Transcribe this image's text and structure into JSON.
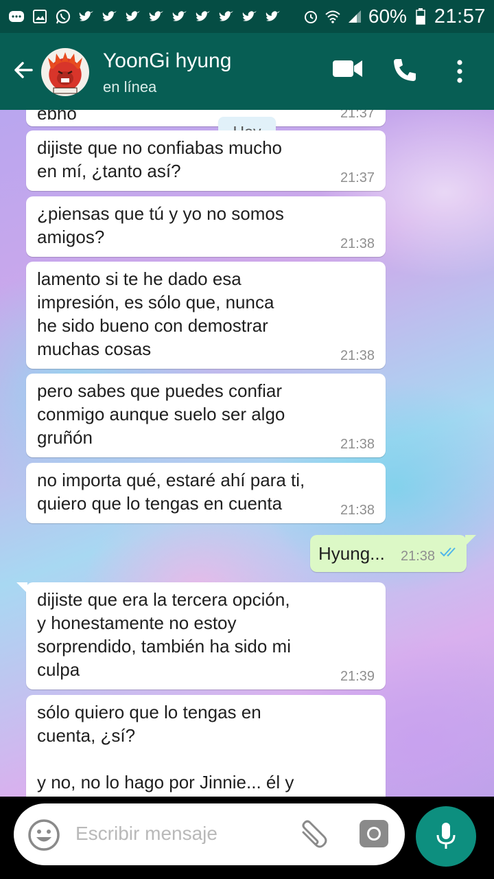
{
  "status_bar": {
    "battery": "60%",
    "time": "21:57"
  },
  "header": {
    "contact_name": "YoonGi hyung",
    "status": "en línea"
  },
  "chat": {
    "date_chip": "Hoy",
    "messages": [
      {
        "direction": "in",
        "text": "ebho",
        "time": "21:37"
      },
      {
        "direction": "in",
        "text": "dijiste que no confiabas mucho\nen mí, ¿tanto así?",
        "time": "21:37"
      },
      {
        "direction": "in",
        "text": "¿piensas que tú y yo no somos\namigos?",
        "time": "21:38"
      },
      {
        "direction": "in",
        "text": "lamento si te he dado esa\nimpresión, es sólo que, nunca\nhe sido bueno con demostrar\nmuchas cosas",
        "time": "21:38"
      },
      {
        "direction": "in",
        "text": "pero sabes que puedes confiar\nconmigo aunque suelo ser algo\ngruñón",
        "time": "21:38"
      },
      {
        "direction": "in",
        "text": "no importa qué, estaré ahí para ti,\nquiero que lo tengas en cuenta",
        "time": "21:38"
      },
      {
        "direction": "out",
        "text": "Hyung...",
        "time": "21:38"
      },
      {
        "direction": "in",
        "text": "dijiste que era la tercera opción,\ny honestamente no estoy\nsorprendido, también ha sido mi\nculpa",
        "time": "21:39"
      },
      {
        "direction": "in",
        "text": "sólo quiero que lo tengas en\ncuenta, ¿sí?\n\ny no, no lo hago por Jinnie... él y",
        "time": ""
      }
    ]
  },
  "composer": {
    "placeholder": "Escribir mensaje"
  }
}
